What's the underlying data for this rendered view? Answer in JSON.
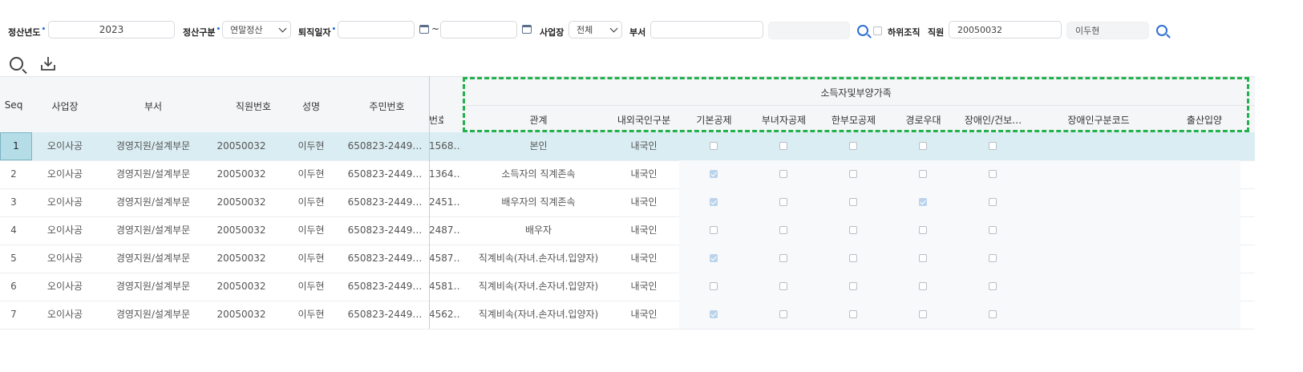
{
  "filters": {
    "year_label": "정산년도",
    "year_value": "2023",
    "type_label": "정산구분",
    "type_value": "연말정산",
    "retire_label": "퇴직일자",
    "retire_sep": "~",
    "workplace_label": "사업장",
    "workplace_value": "전체",
    "dept_label": "부서",
    "sub_org_label": "하위조직",
    "employee_label": "직원",
    "employee_id": "20050032",
    "employee_name": "이두현",
    "required_mark": "•"
  },
  "grid": {
    "headers": {
      "seq": "Seq",
      "workplace": "사업장",
      "dept": "부서",
      "emp_no": "직원번호",
      "name": "성명",
      "resident_no": "주민번호",
      "no_partial": "번호",
      "group": "소득자및부양가족",
      "relation": "관계",
      "nationality": "내외국인구분",
      "basic": "기본공제",
      "woman": "부녀자공제",
      "single_parent": "한부모공제",
      "senior": "경로우대",
      "disabled": "장애인/건보…",
      "disabled_code": "장애인구분코드",
      "birth_adopt": "출산입양"
    },
    "rows": [
      {
        "seq": "1",
        "workplace": "오이사공",
        "dept": "경영지원/설계부문",
        "emp_no": "20050032",
        "name": "이두현",
        "resident_no": "650823-2449…",
        "no_partial": "1568…",
        "relation": "본인",
        "nationality": "내국인",
        "basic": false,
        "woman": false,
        "single_parent": false,
        "senior": false,
        "disabled": false
      },
      {
        "seq": "2",
        "workplace": "오이사공",
        "dept": "경영지원/설계부문",
        "emp_no": "20050032",
        "name": "이두현",
        "resident_no": "650823-2449…",
        "no_partial": "1364…",
        "relation": "소득자의 직계존속",
        "nationality": "내국인",
        "basic": true,
        "woman": false,
        "single_parent": false,
        "senior": false,
        "disabled": false
      },
      {
        "seq": "3",
        "workplace": "오이사공",
        "dept": "경영지원/설계부문",
        "emp_no": "20050032",
        "name": "이두현",
        "resident_no": "650823-2449…",
        "no_partial": "2451…",
        "relation": "배우자의 직계존속",
        "nationality": "내국인",
        "basic": true,
        "woman": false,
        "single_parent": false,
        "senior": true,
        "disabled": false
      },
      {
        "seq": "4",
        "workplace": "오이사공",
        "dept": "경영지원/설계부문",
        "emp_no": "20050032",
        "name": "이두현",
        "resident_no": "650823-2449…",
        "no_partial": "2487…",
        "relation": "배우자",
        "nationality": "내국인",
        "basic": false,
        "woman": false,
        "single_parent": false,
        "senior": false,
        "disabled": false
      },
      {
        "seq": "5",
        "workplace": "오이사공",
        "dept": "경영지원/설계부문",
        "emp_no": "20050032",
        "name": "이두현",
        "resident_no": "650823-2449…",
        "no_partial": "4587…",
        "relation": "직계비속(자녀.손자녀.입양자)",
        "nationality": "내국인",
        "basic": true,
        "woman": false,
        "single_parent": false,
        "senior": false,
        "disabled": false
      },
      {
        "seq": "6",
        "workplace": "오이사공",
        "dept": "경영지원/설계부문",
        "emp_no": "20050032",
        "name": "이두현",
        "resident_no": "650823-2449…",
        "no_partial": "4581…",
        "relation": "직계비속(자녀.손자녀.입양자)",
        "nationality": "내국인",
        "basic": false,
        "woman": false,
        "single_parent": false,
        "senior": false,
        "disabled": false
      },
      {
        "seq": "7",
        "workplace": "오이사공",
        "dept": "경영지원/설계부문",
        "emp_no": "20050032",
        "name": "이두현",
        "resident_no": "650823-2449…",
        "no_partial": "4562…",
        "relation": "직계비속(자녀.손자녀.입양자)",
        "nationality": "내국인",
        "basic": true,
        "woman": false,
        "single_parent": false,
        "senior": false,
        "disabled": false
      }
    ]
  },
  "colors": {
    "accent": "#2f6fd6",
    "selected_row": "#daedf3",
    "highlight_dash": "#22b14c"
  },
  "icons": {
    "search": "search-icon",
    "download": "download-icon",
    "calendar": "calendar-icon"
  }
}
